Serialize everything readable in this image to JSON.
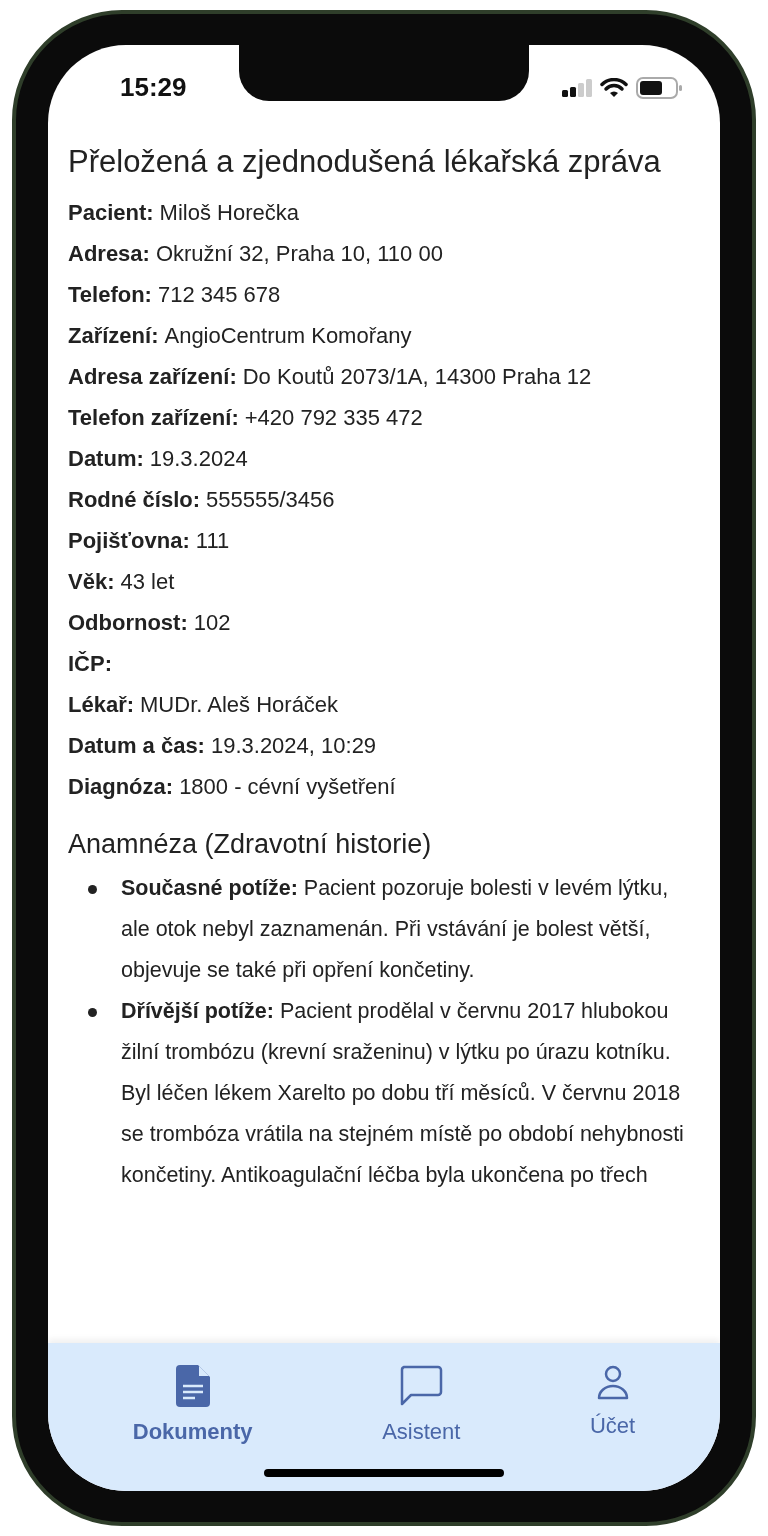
{
  "status_bar": {
    "time": "15:29"
  },
  "document": {
    "title": "Přeložená a zjednodušená lékařská zpráva",
    "fields": [
      {
        "label": "Pacient:",
        "value": "Miloš Horečka"
      },
      {
        "label": "Adresa:",
        "value": "Okružní 32, Praha 10, 110 00"
      },
      {
        "label": "Telefon:",
        "value": "712 345 678"
      },
      {
        "label": "Zařízení:",
        "value": "AngioCentrum Komořany"
      },
      {
        "label": "Adresa zařízení:",
        "value": "Do Koutů 2073/1A, 14300 Praha 12"
      },
      {
        "label": "Telefon zařízení:",
        "value": "+420 792 335 472"
      },
      {
        "label": "Datum:",
        "value": "19.3.2024"
      },
      {
        "label": "Rodné číslo:",
        "value": "555555/3456"
      },
      {
        "label": "Pojišťovna:",
        "value": "111"
      },
      {
        "label": "Věk:",
        "value": "43 let"
      },
      {
        "label": "Odbornost:",
        "value": "102"
      },
      {
        "label": "IČP:"
      },
      {
        "label": "Lékař:",
        "value": "MUDr. Aleš Horáček"
      },
      {
        "label": "Datum a čas:",
        "value": "19.3.2024, 10:29"
      },
      {
        "label": "Diagnóza:",
        "value": "1800 - cévní vyšetření"
      }
    ],
    "section_heading": "Anamnéza (Zdravotní historie)",
    "bullets": [
      {
        "label": "Současné potíže:",
        "text": "Pacient pozoruje bolesti v levém lýtku, ale otok nebyl zaznamenán. Při vstávání je bolest větší, objevuje se také při opření končetiny."
      },
      {
        "label": "Dřívější potíže:",
        "text": "Pacient prodělal v červnu 2017 hlubokou žilní trombózu (krevní sraženinu) v lýtku po úrazu kotníku. Byl léčen lékem Xarelto po dobu tří měsíců. V červnu 2018 se trombóza vrátila na stejném místě po období nehybnosti končetiny. Antikoagulační léčba byla ukončena po třech"
      }
    ]
  },
  "tab_bar": [
    {
      "kind": "document",
      "label": "Dokumenty",
      "selected": true
    },
    {
      "kind": "chat",
      "label": "Asistent",
      "selected": false
    },
    {
      "kind": "person",
      "label": "Účet",
      "selected": false
    }
  ]
}
